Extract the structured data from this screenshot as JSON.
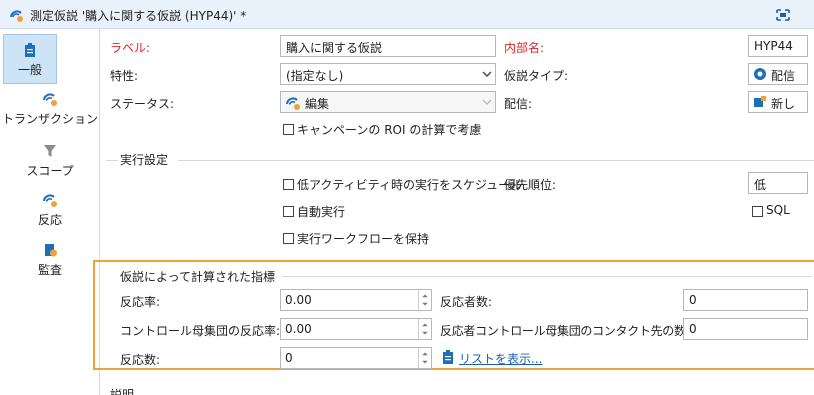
{
  "window": {
    "title": "測定仮説 '購入に関する仮説 (HYP44)' *"
  },
  "sidebar": {
    "items": [
      {
        "label": "一般",
        "icon": "clipboard-icon"
      },
      {
        "label": "トランザクション",
        "icon": "hypothesis-icon"
      },
      {
        "label": "スコープ",
        "icon": "funnel-icon"
      },
      {
        "label": "反応",
        "icon": "reaction-icon"
      },
      {
        "label": "監査",
        "icon": "audit-icon"
      }
    ]
  },
  "general": {
    "label_caption": "ラベル:",
    "label_value": "購入に関する仮説",
    "internal_name_caption": "内部名:",
    "internal_name_value": "HYP44",
    "characteristic_caption": "特性:",
    "characteristic_value": "(指定なし)",
    "hypothesis_type_caption": "仮説タイプ:",
    "hypothesis_type_value": "配信",
    "status_caption": "ステータス:",
    "status_value": "編集",
    "delivery_caption": "配信:",
    "delivery_value": "新し",
    "roi_checkbox_label": "キャンペーンの ROI の計算で考慮"
  },
  "execution": {
    "section_title": "実行設定",
    "schedule_low_activity_label": "低アクティビティ時の実行をスケジュール",
    "priority_caption": "優先順位:",
    "priority_value": "低",
    "auto_execute_label": "自動実行",
    "sql_label": "SQL",
    "keep_workflow_label": "実行ワークフローを保持"
  },
  "metrics": {
    "section_title": "仮説によって計算された指標",
    "response_rate_caption": "反応率:",
    "response_rate_value": "0.00",
    "responder_count_caption": "反応者数:",
    "responder_count_value": "0",
    "control_response_rate_caption": "コントロール母集団の反応率:",
    "control_response_rate_value": "0.00",
    "control_contacts_caption": "反応者コントロール母集団のコンタクト先の数:",
    "control_contacts_value": "0",
    "response_count_caption": "反応数:",
    "response_count_value": "0",
    "show_list_link": "リストを表示..."
  },
  "description": {
    "caption": "説明"
  },
  "colors": {
    "accent": "#f0a23a",
    "required_label": "#d9272e",
    "link": "#1a5fb4",
    "titlebar": "#e9f2fb"
  }
}
